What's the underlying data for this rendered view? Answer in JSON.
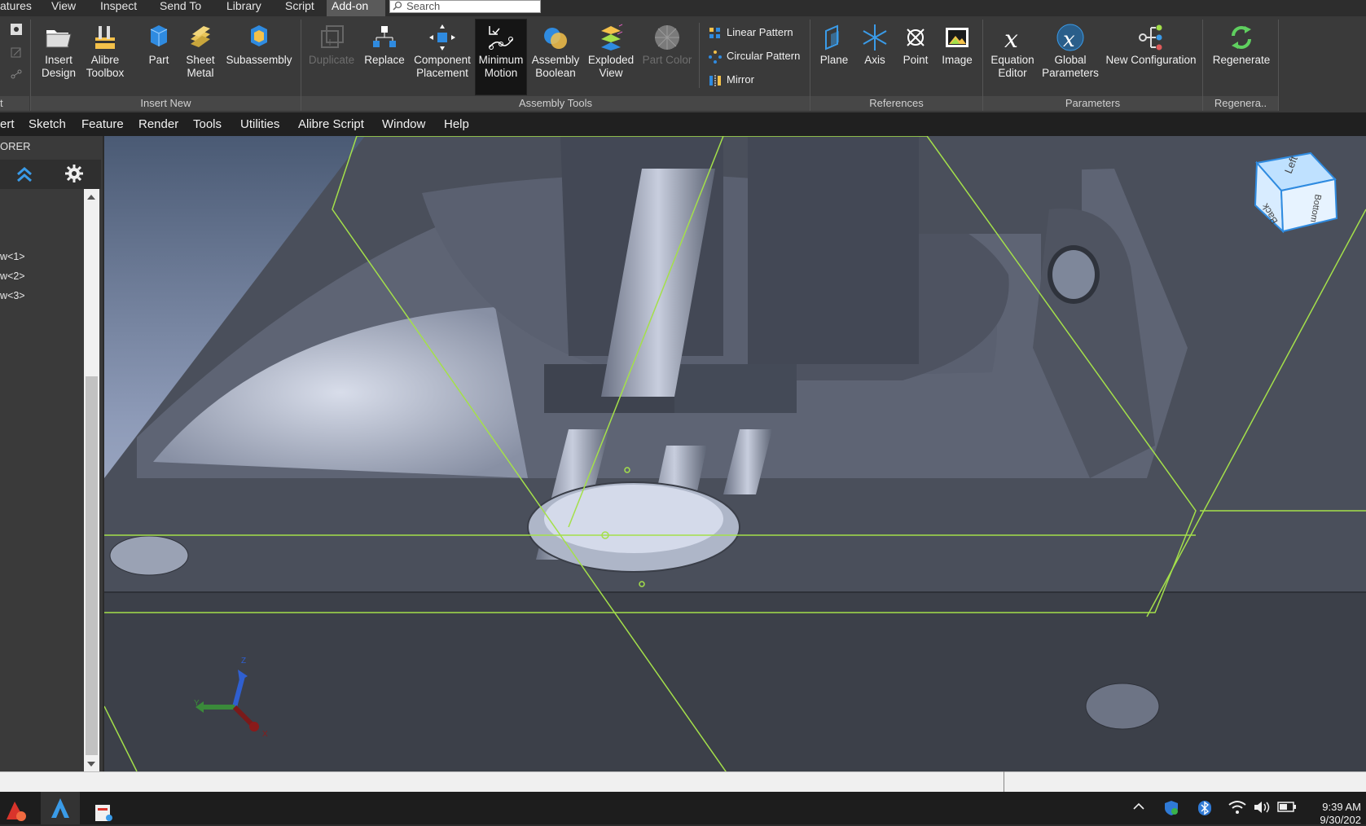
{
  "tabs": [
    "atures",
    "View",
    "Inspect",
    "Send To",
    "Library",
    "Script",
    "Add-on"
  ],
  "search": {
    "placeholder": "Search"
  },
  "ribbon": {
    "insert_new": {
      "label": "Insert New",
      "buttons": [
        "Insert\nDesign",
        "Alibre\nToolbox",
        "Part",
        "Sheet\nMetal",
        "Subassembly"
      ]
    },
    "assembly_tools": {
      "label": "Assembly Tools",
      "buttons": [
        "Duplicate",
        "Replace",
        "Component\nPlacement",
        "Minimum\nMotion",
        "Assembly\nBoolean",
        "Exploded\nView",
        "Part Color"
      ],
      "small_buttons": [
        "Linear Pattern",
        "Circular Pattern",
        "Mirror"
      ]
    },
    "references": {
      "label": "References",
      "buttons": [
        "Plane",
        "Axis",
        "Point",
        "Image"
      ]
    },
    "parameters": {
      "label": "Parameters",
      "buttons": [
        "Equation\nEditor",
        "Global\nParameters",
        "New Configuration"
      ]
    },
    "regenerate": {
      "label": "Regenera..",
      "buttons": [
        "Regenerate"
      ]
    },
    "left_partial_label": "t"
  },
  "menubar": [
    "ert",
    "Sketch",
    "Feature",
    "Render",
    "Tools",
    "Utilities",
    "Alibre Script",
    "Window",
    "Help"
  ],
  "explorer": {
    "title": "ORER",
    "items": [
      "w<1>",
      "w<2>",
      "w<3>"
    ]
  },
  "viewcube": {
    "faces": [
      "Left",
      "Bottom",
      "Back"
    ]
  },
  "triad": {
    "axes": [
      "Z",
      "Y",
      "X"
    ]
  },
  "clock": {
    "time": "9:39 AM",
    "date": "9/30/202"
  },
  "colors": {
    "accent_blue": "#3a9be8",
    "ref_green": "#a4e04a",
    "ribbon_bg": "#3a3a3a"
  }
}
